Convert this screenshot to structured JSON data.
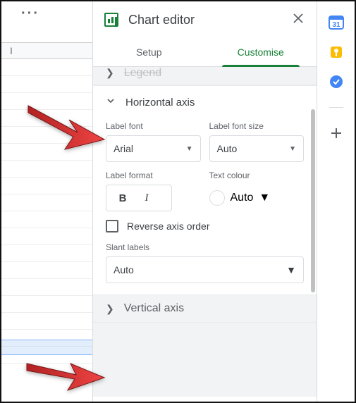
{
  "overflow": "···",
  "sheet": {
    "col": "I"
  },
  "panel": {
    "title": "Chart editor",
    "tabs": {
      "setup": "Setup",
      "customise": "Customise",
      "active": "customise"
    }
  },
  "sections": {
    "legend_collapsed": "Legend",
    "horizontal_axis": {
      "title": "Horizontal axis",
      "label_font": {
        "label": "Label font",
        "value": "Arial"
      },
      "label_font_size": {
        "label": "Label font size",
        "value": "Auto"
      },
      "label_format": {
        "label": "Label format",
        "bold": "B",
        "italic": "I"
      },
      "text_colour": {
        "label": "Text colour",
        "value": "Auto"
      },
      "reverse": "Reverse axis order",
      "slant": {
        "label": "Slant labels",
        "value": "Auto"
      }
    },
    "vertical_axis": {
      "title": "Vertical axis"
    }
  },
  "caret": "▼"
}
